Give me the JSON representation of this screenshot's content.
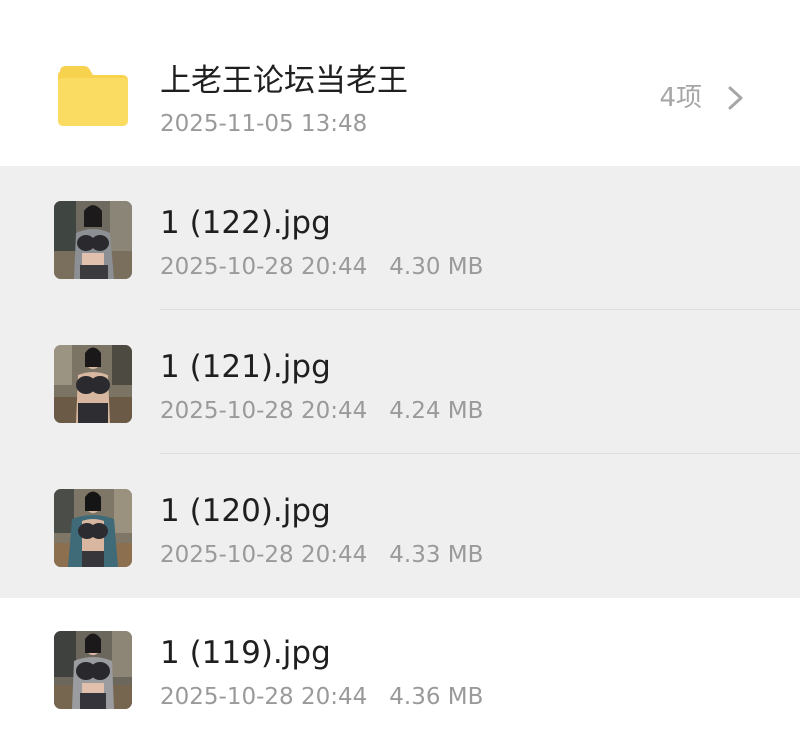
{
  "folder": {
    "name": "上老王论坛当老王",
    "date": "2025-11-05 13:48",
    "count": "4项",
    "icon": "folder-icon",
    "color": "#f9d857"
  },
  "files": [
    {
      "name": "1 (122).jpg",
      "date": "2025-10-28 20:44",
      "size": "4.30 MB",
      "selected": true
    },
    {
      "name": "1 (121).jpg",
      "date": "2025-10-28 20:44",
      "size": "4.24 MB",
      "selected": true
    },
    {
      "name": "1 (120).jpg",
      "date": "2025-10-28 20:44",
      "size": "4.33 MB",
      "selected": true
    },
    {
      "name": "1 (119).jpg",
      "date": "2025-10-28 20:44",
      "size": "4.36 MB",
      "selected": false
    }
  ],
  "colors": {
    "selected_bg": "#efefef",
    "primary_text": "#1f1f1f",
    "secondary_text": "#9a9a9a"
  }
}
